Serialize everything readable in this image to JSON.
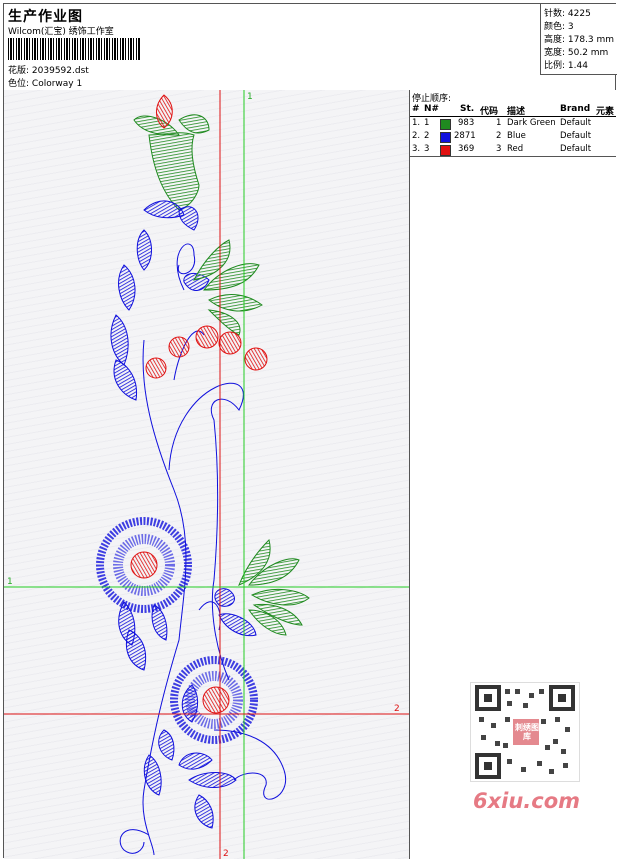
{
  "header": {
    "title": "生产作业图",
    "company": "Wilcom(汇宝) 绣饰工作室",
    "design_label": "花版:",
    "design_value": "2039592.dst",
    "colorway_label": "色位:",
    "colorway_value": "Colorway 1"
  },
  "specs": {
    "stitches": "针数: 4225",
    "colors": "颜色: 3",
    "height": "高度: 178.3 mm",
    "width": "宽度: 50.2 mm",
    "ratio": "比例: 1.44"
  },
  "stop_sequence": {
    "title": "停止顺序:",
    "headers": [
      "#",
      "N#",
      "St.",
      "代码",
      "描述",
      "Brand",
      "元素"
    ],
    "rows": [
      {
        "index": "1.",
        "n": "1",
        "stitches": "983",
        "code": "1",
        "desc": "Dark Green",
        "brand": "Default",
        "color": "#1f8a1f"
      },
      {
        "index": "2.",
        "n": "2",
        "stitches": "2871",
        "code": "2",
        "desc": "Blue",
        "brand": "Default",
        "color": "#1010dd"
      },
      {
        "index": "3.",
        "n": "3",
        "stitches": "369",
        "code": "3",
        "desc": "Red",
        "brand": "Default",
        "color": "#e01010"
      }
    ]
  },
  "guides": {
    "top_marker": "1",
    "left_marker": "1",
    "right_marker": "2",
    "bottom_marker": "2"
  },
  "watermark": {
    "text": "6xiu.com",
    "qr_caption": "刺绣图库"
  },
  "colors": {
    "green": "#1f8a1f",
    "blue": "#1010dd",
    "red": "#e01010",
    "guide_green": "#22cc22",
    "guide_red": "#dd1111"
  }
}
